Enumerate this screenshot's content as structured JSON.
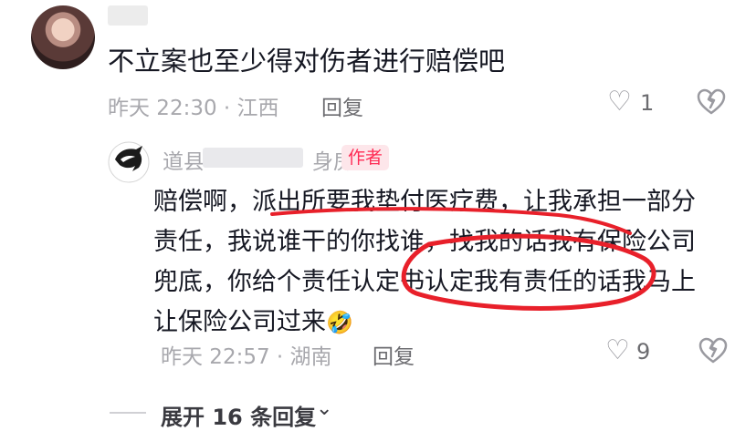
{
  "comment": {
    "text": "不立案也至少得对伤者进行赔偿吧",
    "meta": "昨天 22:30 · 江西",
    "reply_label": "回复",
    "like_count": "1"
  },
  "reply": {
    "username_start": "道县",
    "username_end": "身房",
    "badge": "作者",
    "text": "赔偿啊，派出所要我垫付医疗费，让我承担一部分责任，我说谁干的你找谁，找我的话我有保险公司兜底，你给个责任认定书认定我有责任的话我马上让保险公司过来",
    "emoji": "🤣",
    "meta": "昨天 22:57 · 湖南",
    "reply_label": "回复",
    "like_count": "9"
  },
  "expand": {
    "label": "展开 16 条回复"
  },
  "colors": {
    "annotation": "#e8202a",
    "author_badge": "#fe2c55"
  }
}
